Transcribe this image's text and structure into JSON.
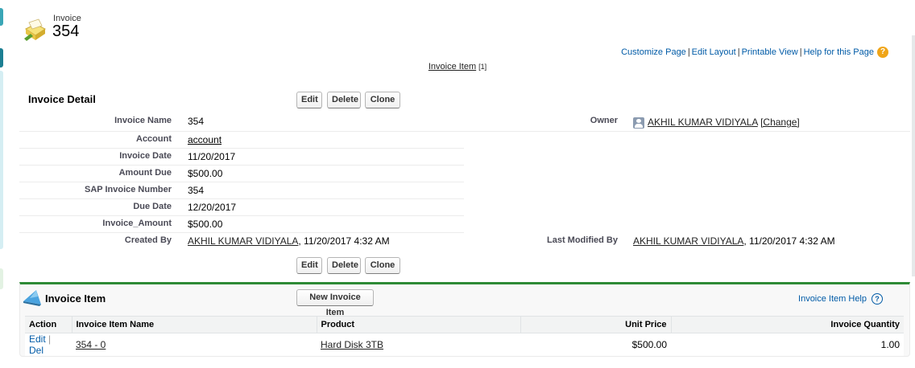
{
  "header": {
    "object_label": "Invoice",
    "record_name": "354"
  },
  "top_links": [
    "Customize Page",
    "Edit Layout",
    "Printable View",
    "Help for this Page"
  ],
  "related_link": {
    "label": "Invoice Item",
    "count": "[1]"
  },
  "detail": {
    "section_title": "Invoice Detail",
    "buttons": {
      "edit": "Edit",
      "delete": "Delete",
      "clone": "Clone"
    },
    "fields": {
      "invoice_name": {
        "label": "Invoice Name",
        "value": "354"
      },
      "account": {
        "label": "Account",
        "value": "account"
      },
      "invoice_date": {
        "label": "Invoice Date",
        "value": "11/20/2017"
      },
      "amount_due": {
        "label": "Amount Due",
        "value": "$500.00"
      },
      "sap_invoice_number": {
        "label": "SAP Invoice Number",
        "value": "354"
      },
      "due_date": {
        "label": "Due Date",
        "value": "12/20/2017"
      },
      "invoice_amount": {
        "label": "Invoice_Amount",
        "value": "$500.00"
      },
      "created_by": {
        "label": "Created By",
        "user": "AKHIL KUMAR VIDIYALA",
        "timestamp": ", 11/20/2017 4:32 AM"
      },
      "owner": {
        "label": "Owner",
        "user": "AKHIL KUMAR VIDIYALA",
        "change": "[Change]"
      },
      "last_modified_by": {
        "label": "Last Modified By",
        "user": "AKHIL KUMAR VIDIYALA",
        "timestamp": ", 11/20/2017 4:32 AM"
      }
    }
  },
  "related_list": {
    "title": "Invoice Item",
    "new_button": "New Invoice Item",
    "help": "Invoice Item Help",
    "columns": [
      "Action",
      "Invoice Item Name",
      "Product",
      "Unit Price",
      "Invoice Quantity"
    ],
    "rows": [
      {
        "edit": "Edit",
        "sep": "|",
        "del": "Del",
        "name": "354 - 0",
        "product": "Hard Disk 3TB",
        "unit_price": "$500.00",
        "quantity": "1.00"
      }
    ]
  },
  "colors": {
    "link_blue": "#015ba7",
    "section_green": "#2e8b36",
    "help_orange": "#f0a518"
  },
  "icons": {
    "object": "invoice-folder-icon",
    "owner": "user-avatar-icon",
    "related": "related-list-tab-icon"
  }
}
